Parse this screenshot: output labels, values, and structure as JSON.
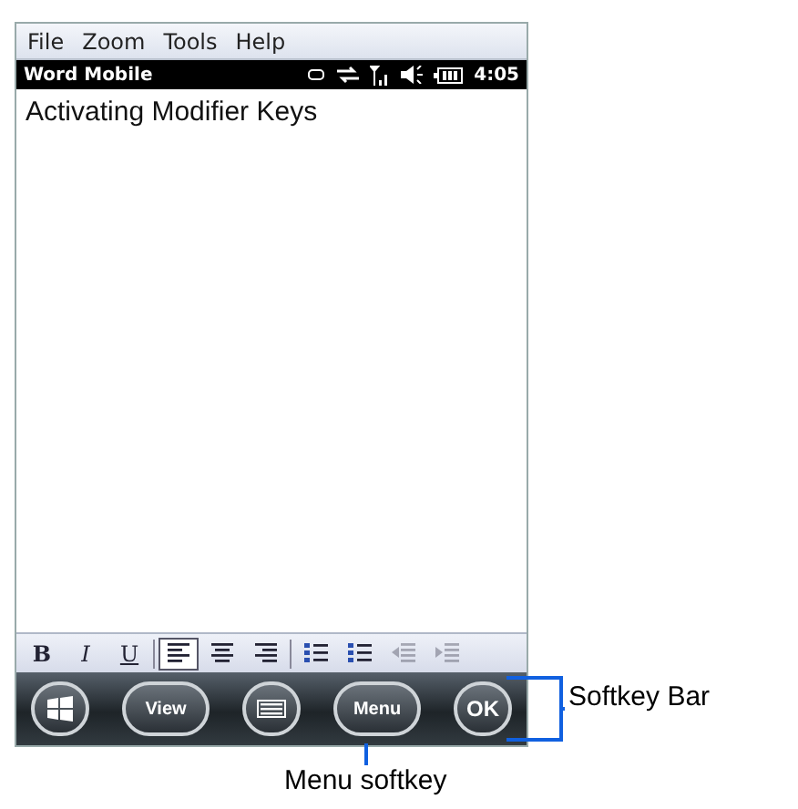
{
  "menu_bar": [
    "File",
    "Zoom",
    "Tools",
    "Help"
  ],
  "title_bar": {
    "title": "Word Mobile",
    "time": "4:05"
  },
  "document": {
    "text": "Activating Modifier Keys"
  },
  "format_toolbar": [
    {
      "kind": "bold",
      "label": "B",
      "selected": false
    },
    {
      "kind": "italic",
      "label": "I",
      "selected": false
    },
    {
      "kind": "underline",
      "label": "U",
      "selected": false
    },
    {
      "kind": "left",
      "selected": true
    },
    {
      "kind": "center",
      "selected": false
    },
    {
      "kind": "right",
      "selected": false
    },
    {
      "kind": "numbered",
      "selected": false
    },
    {
      "kind": "bulleted",
      "selected": false
    },
    {
      "kind": "outdent",
      "disabled": true
    },
    {
      "kind": "indent",
      "disabled": true
    }
  ],
  "softkeys": [
    {
      "kind": "start"
    },
    {
      "kind": "text",
      "label": "View"
    },
    {
      "kind": "keyboard"
    },
    {
      "kind": "text",
      "label": "Menu"
    },
    {
      "kind": "round",
      "label": "OK"
    }
  ],
  "annotations": {
    "softkey_bar": "Softkey Bar",
    "menu_softkey": "Menu softkey"
  }
}
